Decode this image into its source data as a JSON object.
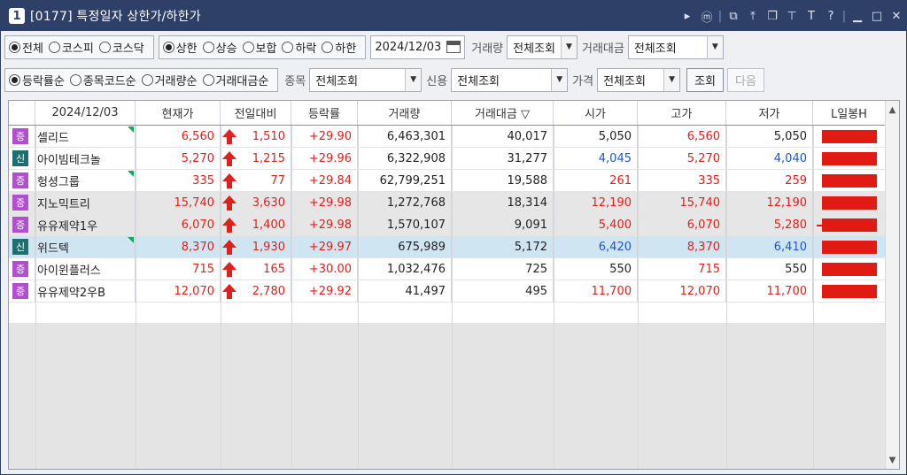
{
  "window": {
    "num": "1",
    "title": "[0177] 특정일자 상한가/하한가",
    "icons": [
      "play-icon",
      "m-icon",
      "new-window-icon",
      "pin-top-icon",
      "copy-window-icon",
      "stick-icon",
      "font-icon",
      "help-icon",
      "minimize-icon",
      "maximize-icon",
      "close-icon"
    ]
  },
  "row1": {
    "market": [
      {
        "label": "전체",
        "on": true
      },
      {
        "label": "코스피",
        "on": false
      },
      {
        "label": "코스닥",
        "on": false
      }
    ],
    "limit": [
      {
        "label": "상한",
        "on": true
      },
      {
        "label": "상승",
        "on": false
      },
      {
        "label": "보합",
        "on": false
      },
      {
        "label": "하락",
        "on": false
      },
      {
        "label": "하한",
        "on": false
      }
    ],
    "date": "2024/12/03",
    "volume_label": "거래량",
    "volume_value": "전체조회",
    "amount_label": "거래대금",
    "amount_value": "전체조회"
  },
  "row2": {
    "sort": [
      {
        "label": "등락률순",
        "on": true
      },
      {
        "label": "종목코드순",
        "on": false
      },
      {
        "label": "거래량순",
        "on": false
      },
      {
        "label": "거래대금순",
        "on": false
      }
    ],
    "stock_label": "종목",
    "stock_value": "전체조회",
    "credit_label": "신용",
    "credit_value": "전체조회",
    "price_label": "가격",
    "price_value": "전체조회",
    "search_btn": "조회",
    "next_btn": "다음"
  },
  "table": {
    "headers": [
      "2024/12/03",
      "현재가",
      "전일대비",
      "등락률",
      "거래량",
      "거래대금 ▽",
      "시가",
      "고가",
      "저가",
      "L일봉H"
    ],
    "rows": [
      {
        "badge": "증",
        "badge_color": "#b14fd0",
        "name": "셀리드",
        "tri": true,
        "price": "6,560",
        "diff": "1,510",
        "rate": "+29.90",
        "vol": "6,463,301",
        "amt": "40,017",
        "open": "5,050",
        "open_c": "blk",
        "high": "6,560",
        "high_c": "red",
        "low": "5,050",
        "low_c": "blk",
        "bg": "#ffffff",
        "lline": false
      },
      {
        "badge": "신",
        "badge_color": "#1f6e70",
        "name": "아이빔테크놀",
        "tri": false,
        "price": "5,270",
        "diff": "1,215",
        "rate": "+29.96",
        "vol": "6,322,908",
        "amt": "31,277",
        "open": "4,045",
        "open_c": "blue",
        "high": "5,270",
        "high_c": "red",
        "low": "4,040",
        "low_c": "blue",
        "bg": "#ffffff",
        "lline": false
      },
      {
        "badge": "증",
        "badge_color": "#b14fd0",
        "name": "헝셩그룹",
        "tri": true,
        "price": "335",
        "diff": "77",
        "rate": "+29.84",
        "vol": "62,799,251",
        "amt": "19,588",
        "open": "261",
        "open_c": "red",
        "high": "335",
        "high_c": "red",
        "low": "259",
        "low_c": "red",
        "bg": "#ffffff",
        "lline": false
      },
      {
        "badge": "증",
        "badge_color": "#b14fd0",
        "name": "지노믹트리",
        "tri": false,
        "price": "15,740",
        "diff": "3,630",
        "rate": "+29.98",
        "vol": "1,272,768",
        "amt": "18,314",
        "open": "12,190",
        "open_c": "red",
        "high": "15,740",
        "high_c": "red",
        "low": "12,190",
        "low_c": "red",
        "bg": "#e6e6e6",
        "lline": false
      },
      {
        "badge": "증",
        "badge_color": "#b14fd0",
        "name": "유유제약1우",
        "tri": false,
        "price": "6,070",
        "diff": "1,400",
        "rate": "+29.98",
        "vol": "1,570,107",
        "amt": "9,091",
        "open": "5,400",
        "open_c": "red",
        "high": "6,070",
        "high_c": "red",
        "low": "5,280",
        "low_c": "red",
        "bg": "#e6e6e6",
        "lline": true
      },
      {
        "badge": "신",
        "badge_color": "#1f6e70",
        "name": "위드텍",
        "tri": true,
        "price": "8,370",
        "diff": "1,930",
        "rate": "+29.97",
        "vol": "675,989",
        "amt": "5,172",
        "open": "6,420",
        "open_c": "blue",
        "high": "8,370",
        "high_c": "red",
        "low": "6,410",
        "low_c": "blue",
        "bg": "#cfe6f2",
        "lline": false
      },
      {
        "badge": "증",
        "badge_color": "#b14fd0",
        "name": "아이윈플러스",
        "tri": false,
        "price": "715",
        "diff": "165",
        "rate": "+30.00",
        "vol": "1,032,476",
        "amt": "725",
        "open": "550",
        "open_c": "blk",
        "high": "715",
        "high_c": "red",
        "low": "550",
        "low_c": "blk",
        "bg": "#ffffff",
        "lline": false
      },
      {
        "badge": "증",
        "badge_color": "#b14fd0",
        "name": "유유제약2우B",
        "tri": false,
        "price": "12,070",
        "diff": "2,780",
        "rate": "+29.92",
        "vol": "41,497",
        "amt": "495",
        "open": "11,700",
        "open_c": "red",
        "high": "12,070",
        "high_c": "red",
        "low": "11,700",
        "low_c": "red",
        "bg": "#ffffff",
        "lline": false
      }
    ]
  }
}
